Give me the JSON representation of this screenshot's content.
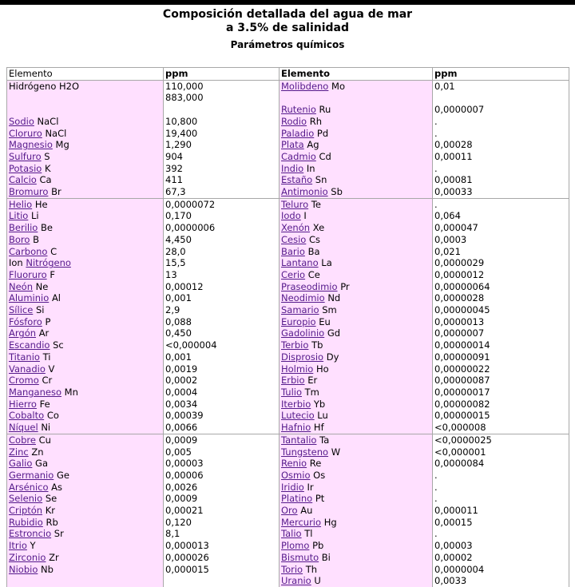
{
  "title_line1": "Composición detallada del agua de mar",
  "title_line2": "a 3.5% de salinidad",
  "subtitle": "Parámetros químicos",
  "headers": [
    "Elemento",
    "ppm",
    "Elemento",
    "ppm"
  ],
  "groups": [
    [
      [
        {
          "name": "Hidrógeno",
          "sym": "H2O",
          "link": false
        },
        "110,000\n883,000",
        {
          "name": "Molibdeno",
          "sym": "Mo",
          "link": true
        },
        "0,01"
      ],
      [
        null,
        null,
        {
          "name": "Rutenio",
          "sym": "Ru",
          "link": true
        },
        "0,0000007"
      ],
      [
        {
          "name": "Sodio",
          "sym": "NaCl",
          "link": true
        },
        "10,800",
        {
          "name": "Rodio",
          "sym": "Rh",
          "link": true
        },
        "."
      ],
      [
        {
          "name": "Cloruro",
          "sym": "NaCl",
          "link": true
        },
        "19,400",
        {
          "name": "Paladio",
          "sym": "Pd",
          "link": true
        },
        "."
      ],
      [
        {
          "name": "Magnesio",
          "sym": "Mg",
          "link": true
        },
        "1,290",
        {
          "name": "Plata",
          "sym": "Ag",
          "link": true
        },
        "0,00028"
      ],
      [
        {
          "name": "Sulfuro",
          "sym": "S",
          "link": true
        },
        "904",
        {
          "name": "Cadmio",
          "sym": "Cd",
          "link": true
        },
        "0,00011"
      ],
      [
        {
          "name": "Potasio",
          "sym": "K",
          "link": true
        },
        "392",
        {
          "name": "Indio",
          "sym": "In",
          "link": true
        },
        "."
      ],
      [
        {
          "name": "Calcio",
          "sym": "Ca",
          "link": true
        },
        "411",
        {
          "name": "Estaño",
          "sym": "Sn",
          "link": true
        },
        "0,00081"
      ],
      [
        {
          "name": "Bromuro",
          "sym": "Br",
          "link": true
        },
        "67,3",
        {
          "name": "Antimonio",
          "sym": "Sb",
          "link": true
        },
        "0,00033"
      ]
    ],
    [
      [
        {
          "name": "Helio",
          "sym": "He",
          "link": true
        },
        "0,0000072",
        {
          "name": "Teluro",
          "sym": "Te",
          "link": true
        },
        "."
      ],
      [
        {
          "name": "Litio",
          "sym": "Li",
          "link": true
        },
        "0,170",
        {
          "name": "Iodo",
          "sym": "I",
          "link": true
        },
        "0,064"
      ],
      [
        {
          "name": "Berilio",
          "sym": "Be",
          "link": true
        },
        "0,0000006",
        {
          "name": "Xenón",
          "sym": "Xe",
          "link": true
        },
        "0,000047"
      ],
      [
        {
          "name": "Boro",
          "sym": "B",
          "link": true
        },
        "4,450",
        {
          "name": "Cesio",
          "sym": "Cs",
          "link": true
        },
        "0,0003"
      ],
      [
        {
          "name": "Carbono",
          "sym": "C",
          "link": true
        },
        "28,0",
        {
          "name": "Bario",
          "sym": "Ba",
          "link": true
        },
        "0,021"
      ],
      [
        {
          "pre": "Ion ",
          "name": "Nitrógeno",
          "sym": "",
          "link": true
        },
        "15,5",
        {
          "name": "Lantano",
          "sym": "La",
          "link": true
        },
        "0,0000029"
      ],
      [
        {
          "name": "Fluoruro",
          "sym": "F",
          "link": true
        },
        "13",
        {
          "name": "Cerio",
          "sym": "Ce",
          "link": true
        },
        "0,0000012"
      ],
      [
        {
          "name": "Neón",
          "sym": "Ne",
          "link": true
        },
        "0,00012",
        {
          "name": "Praseodimio",
          "sym": "Pr",
          "link": true
        },
        "0,00000064"
      ],
      [
        {
          "name": "Aluminio",
          "sym": "Al",
          "link": true
        },
        "0,001",
        {
          "name": "Neodimio",
          "sym": "Nd",
          "link": true
        },
        "0,0000028"
      ],
      [
        {
          "name": "Sílice",
          "sym": "Si",
          "link": true
        },
        "2,9",
        {
          "name": "Samario",
          "sym": "Sm",
          "link": true
        },
        "0,00000045"
      ],
      [
        {
          "name": "Fósforo",
          "sym": "P",
          "link": true
        },
        "0,088",
        {
          "name": "Europio",
          "sym": "Eu",
          "link": true
        },
        "0,0000013"
      ],
      [
        {
          "name": "Argón",
          "sym": "Ar",
          "link": true
        },
        "0,450",
        {
          "name": "Gadolinio",
          "sym": "Gd",
          "link": true
        },
        "0,0000007"
      ],
      [
        {
          "name": "Escandio",
          "sym": "Sc",
          "link": true
        },
        "<0,000004",
        {
          "name": "Terbio",
          "sym": "Tb",
          "link": true
        },
        "0,00000014"
      ],
      [
        {
          "name": "Titanio",
          "sym": "Ti",
          "link": true
        },
        "0,001",
        {
          "name": "Disprosio",
          "sym": "Dy",
          "link": true
        },
        "0,00000091"
      ],
      [
        {
          "name": "Vanadio",
          "sym": "V",
          "link": true
        },
        "0,0019",
        {
          "name": "Holmio",
          "sym": "Ho",
          "link": true
        },
        "0,00000022"
      ],
      [
        {
          "name": "Cromo",
          "sym": "Cr",
          "link": true
        },
        "0,0002",
        {
          "name": "Erbio",
          "sym": "Er",
          "link": true
        },
        "0,00000087"
      ],
      [
        {
          "name": "Manganeso",
          "sym": "Mn",
          "link": true
        },
        "0,0004",
        {
          "name": "Tulio",
          "sym": "Tm",
          "link": true
        },
        "0,00000017"
      ],
      [
        {
          "name": "Hierro",
          "sym": "Fe",
          "link": true
        },
        "0,0034",
        {
          "name": "Iterbio",
          "sym": "Yb",
          "link": true
        },
        "0,00000082"
      ],
      [
        {
          "name": "Cobalto",
          "sym": "Co",
          "link": true
        },
        "0,00039",
        {
          "name": "Lutecio",
          "sym": "Lu",
          "link": true
        },
        "0,00000015"
      ],
      [
        {
          "name": "Níquel",
          "sym": "Ni",
          "link": true
        },
        "0,0066",
        {
          "name": "Hafnio",
          "sym": "Hf",
          "link": true
        },
        "<0,000008"
      ]
    ],
    [
      [
        {
          "name": "Cobre",
          "sym": "Cu",
          "link": true
        },
        "0,0009",
        {
          "name": "Tantalio",
          "sym": "Ta",
          "link": true
        },
        "<0,0000025"
      ],
      [
        {
          "name": "Zinc",
          "sym": "Zn",
          "link": true
        },
        "0,005",
        {
          "name": "Tungsteno",
          "sym": "W",
          "link": true
        },
        "<0,000001"
      ],
      [
        {
          "name": "Galio",
          "sym": "Ga",
          "link": true
        },
        "0,00003",
        {
          "name": "Renio",
          "sym": "Re",
          "link": true
        },
        "0,0000084"
      ],
      [
        {
          "name": "Germanio",
          "sym": "Ge",
          "link": true
        },
        "0,00006",
        {
          "name": "Osmio",
          "sym": "Os",
          "link": true
        },
        "."
      ],
      [
        {
          "name": "Arsénico",
          "sym": "As",
          "link": true
        },
        "0,0026",
        {
          "name": "Iridio",
          "sym": "Ir",
          "link": true
        },
        "."
      ],
      [
        {
          "name": "Selenio",
          "sym": "Se",
          "link": true
        },
        "0,0009",
        {
          "name": "Platino",
          "sym": "Pt",
          "link": true
        },
        "."
      ],
      [
        {
          "name": "Criptón",
          "sym": "Kr",
          "link": true
        },
        "0,00021",
        {
          "name": "Oro",
          "sym": "Au",
          "link": true
        },
        "0,000011"
      ],
      [
        {
          "name": "Rubidio",
          "sym": "Rb",
          "link": true
        },
        "0,120",
        {
          "name": "Mercurio",
          "sym": "Hg",
          "link": true
        },
        "0,00015"
      ],
      [
        {
          "name": "Estroncio",
          "sym": "Sr",
          "link": true
        },
        "8,1",
        {
          "name": "Talio",
          "sym": "Tl",
          "link": true
        },
        "."
      ],
      [
        {
          "name": "Itrio",
          "sym": "Y",
          "link": true
        },
        "0,000013",
        {
          "name": "Plomo",
          "sym": "Pb",
          "link": true
        },
        "0,00003"
      ],
      [
        {
          "name": "Zirconio",
          "sym": "Zr",
          "link": true
        },
        "0,000026",
        {
          "name": "Bismuto",
          "sym": "Bi",
          "link": true
        },
        "0,00002"
      ],
      [
        {
          "name": "Niobio",
          "sym": "Nb",
          "link": true
        },
        "0,000015",
        {
          "name": "Torio",
          "sym": "Th",
          "link": true
        },
        "0,0000004"
      ],
      [
        null,
        null,
        {
          "name": "Uranio",
          "sym": "U",
          "link": true
        },
        "0,0033"
      ]
    ]
  ]
}
